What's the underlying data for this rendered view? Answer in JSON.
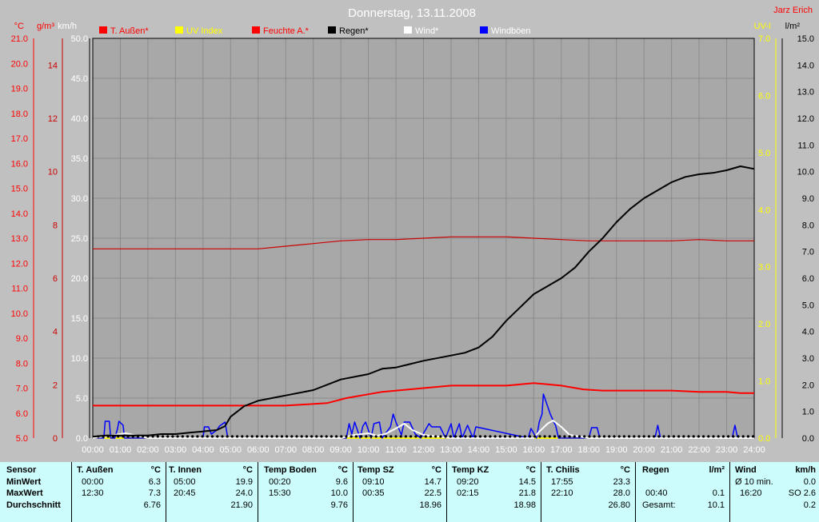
{
  "title": "Donnerstag, 13.11.2008",
  "owner": "Jarz Erich",
  "colors": {
    "background": "#c0c0c0",
    "plot": "#a8a8a8",
    "grid": "#8c8c8c",
    "temp": "#ff0000",
    "humidity": "#cc0000",
    "rain": "#000000",
    "wind": "#ffffff",
    "gust": "#0000ff",
    "uv": "#ffff00",
    "table": "#cdfcfc"
  },
  "chart_data": {
    "type": "line",
    "title": "Donnerstag, 13.11.2008",
    "x_ticks": [
      "00:00",
      "01:00",
      "02:00",
      "03:00",
      "04:00",
      "05:00",
      "06:00",
      "07:00",
      "08:00",
      "09:00",
      "10:00",
      "11:00",
      "12:00",
      "13:00",
      "14:00",
      "15:00",
      "16:00",
      "17:00",
      "18:00",
      "19:00",
      "20:00",
      "21:00",
      "22:00",
      "23:00",
      "24:00"
    ],
    "x_range_hours": [
      0,
      24
    ],
    "legend": [
      "T. Außen*",
      "UV Index",
      "Feuchte A.*",
      "Regen*",
      "Wind*",
      "Windböen"
    ],
    "axes": {
      "temp": {
        "unit": "°C",
        "range": [
          5.0,
          21.0
        ],
        "ticks": [
          "5.0",
          "6.0",
          "7.0",
          "8.0",
          "9.0",
          "10.0",
          "11.0",
          "12.0",
          "13.0",
          "14.0",
          "15.0",
          "16.0",
          "17.0",
          "18.0",
          "19.0",
          "20.0",
          "21.0"
        ]
      },
      "humidity": {
        "unit": "g/m³",
        "range": [
          0,
          15
        ],
        "ticks": [
          "0",
          "2",
          "4",
          "6",
          "8",
          "10",
          "12",
          "14"
        ]
      },
      "wind": {
        "unit": "km/h",
        "range": [
          0,
          50
        ],
        "ticks": [
          "0.0",
          "5.0",
          "10.0",
          "15.0",
          "20.0",
          "25.0",
          "30.0",
          "35.0",
          "40.0",
          "45.0",
          "50.0"
        ]
      },
      "uv": {
        "unit": "UV-I",
        "range": [
          0,
          7
        ],
        "ticks": [
          "0.0",
          "1.0",
          "2.0",
          "3.0",
          "4.0",
          "5.0",
          "6.0",
          "7.0"
        ]
      },
      "rain": {
        "unit": "l/m²",
        "range": [
          0,
          15
        ],
        "ticks": [
          "0.0",
          "1.0",
          "2.0",
          "3.0",
          "4.0",
          "5.0",
          "6.0",
          "7.0",
          "8.0",
          "9.0",
          "10.0",
          "11.0",
          "12.0",
          "13.0",
          "14.0",
          "15.0"
        ]
      }
    },
    "series": [
      {
        "name": "T. Außen*",
        "axis": "temp",
        "x": [
          0,
          4,
          6,
          7,
          8.5,
          9.2,
          10.5,
          12,
          13,
          14,
          15,
          16,
          16.5,
          17,
          17.8,
          18.5,
          19,
          20,
          21,
          22,
          23,
          23.5,
          24
        ],
        "y": [
          6.3,
          6.3,
          6.3,
          6.3,
          6.4,
          6.6,
          6.85,
          7.0,
          7.1,
          7.1,
          7.1,
          7.2,
          7.15,
          7.1,
          6.95,
          6.9,
          6.9,
          6.9,
          6.9,
          6.85,
          6.85,
          6.8,
          6.8
        ]
      },
      {
        "name": "Feuchte A.*",
        "axis": "humidity",
        "x": [
          0,
          4,
          6,
          7,
          8,
          9,
          10,
          11,
          12,
          13,
          14,
          15,
          16,
          17,
          18,
          19,
          20,
          21,
          22,
          23,
          24
        ],
        "y": [
          7.1,
          7.1,
          7.1,
          7.2,
          7.3,
          7.4,
          7.45,
          7.45,
          7.5,
          7.55,
          7.55,
          7.55,
          7.5,
          7.45,
          7.4,
          7.4,
          7.4,
          7.4,
          7.45,
          7.4,
          7.4
        ]
      },
      {
        "name": "Regen*",
        "axis": "rain",
        "x": [
          0,
          0.5,
          1,
          2,
          2.5,
          3,
          3.5,
          4,
          4.5,
          4.8,
          5,
          5.5,
          6,
          6.5,
          7,
          8,
          9,
          10,
          10.5,
          11,
          12,
          13,
          13.5,
          14,
          14.5,
          15,
          15.5,
          16,
          16.5,
          17,
          17.5,
          18,
          18.5,
          19,
          19.5,
          20,
          20.5,
          21,
          21.5,
          22,
          22.5,
          23,
          23.5,
          24
        ],
        "y": [
          0.05,
          0.1,
          0.1,
          0.1,
          0.15,
          0.15,
          0.2,
          0.25,
          0.3,
          0.45,
          0.8,
          1.2,
          1.4,
          1.5,
          1.6,
          1.8,
          2.2,
          2.4,
          2.6,
          2.65,
          2.9,
          3.1,
          3.2,
          3.4,
          3.8,
          4.4,
          4.9,
          5.4,
          5.7,
          6.0,
          6.4,
          7.0,
          7.5,
          8.1,
          8.6,
          9.0,
          9.3,
          9.6,
          9.8,
          9.9,
          9.95,
          10.05,
          10.2,
          10.1
        ]
      },
      {
        "name": "Wind*",
        "axis": "wind",
        "x": [
          0,
          0.6,
          1.2,
          1.6,
          2,
          3,
          9,
          9.5,
          10,
          10.3,
          10.6,
          11,
          11.3,
          11.6,
          12,
          13,
          15,
          16,
          16.2,
          16.5,
          16.7,
          17,
          17.3,
          18,
          24
        ],
        "y": [
          0,
          0.3,
          0.6,
          0.3,
          0,
          0,
          0,
          0.4,
          0.6,
          0.3,
          0.5,
          1.2,
          1.8,
          1.0,
          0.4,
          0,
          0,
          0,
          0.8,
          1.8,
          2.2,
          1.4,
          0.4,
          0,
          0
        ]
      },
      {
        "name": "Windböen",
        "axis": "wind",
        "x": [
          0,
          0.4,
          0.45,
          0.6,
          0.65,
          0.8,
          0.9,
          0.95,
          1.1,
          1.15,
          4,
          4.05,
          4.2,
          4.3,
          4.5,
          4.6,
          4.8,
          4.9,
          9.2,
          9.3,
          9.4,
          9.5,
          9.7,
          9.8,
          9.9,
          10.1,
          10.2,
          10.4,
          10.5,
          10.8,
          10.9,
          11,
          11.2,
          11.3,
          11.5,
          11.7,
          11.9,
          12.2,
          12.3,
          12.6,
          12.8,
          13,
          13.1,
          13.3,
          13.4,
          13.6,
          13.8,
          13.9,
          15.8,
          15.9,
          16.1,
          16.2,
          16.3,
          16.35,
          16.5,
          16.6,
          16.8,
          16.9,
          17.2,
          18,
          18.1,
          18.3,
          18.4,
          20.4,
          20.5,
          20.6,
          23.2,
          23.3,
          23.4,
          24
        ],
        "y": [
          0,
          0,
          2.1,
          2.1,
          0,
          0,
          1.2,
          2.1,
          1.6,
          0,
          0,
          1.4,
          1.4,
          0.5,
          1.0,
          1.5,
          2.0,
          0,
          0,
          1.8,
          0.5,
          2.0,
          0,
          1.5,
          2.0,
          0,
          1.8,
          2.0,
          0,
          1.4,
          3.0,
          2.0,
          0.4,
          2.0,
          2.0,
          0.5,
          0,
          1.8,
          1.4,
          1.4,
          0,
          1.8,
          0,
          1.8,
          0,
          1.6,
          0,
          1.4,
          0,
          1.2,
          0,
          2.0,
          3.0,
          5.5,
          4.0,
          3.0,
          1.5,
          0,
          0,
          0,
          1.3,
          1.3,
          0,
          0,
          1.6,
          0,
          0,
          1.6,
          0,
          0
        ]
      },
      {
        "name": "UV Index",
        "axis": "uv",
        "x": [
          0,
          24
        ],
        "y": [
          0,
          0
        ]
      }
    ]
  },
  "table": {
    "rows": [
      "MinWert",
      "MaxWert",
      "Durchschnitt"
    ],
    "sensor_label": "Sensor",
    "columns": [
      {
        "name": "T. Außen",
        "unit": "°C",
        "min_time": "00:00",
        "min": "6.3",
        "max_time": "12:30",
        "max": "7.3",
        "avg": "6.76"
      },
      {
        "name": "T. Innen",
        "unit": "°C",
        "min_time": "05:00",
        "min": "19.9",
        "max_time": "20:45",
        "max": "24.0",
        "avg": "21.90"
      },
      {
        "name": "Temp Boden",
        "unit": "°C",
        "min_time": "00:20",
        "min": "9.6",
        "max_time": "15:30",
        "max": "10.0",
        "avg": "9.76"
      },
      {
        "name": "Temp SZ",
        "unit": "°C",
        "min_time": "09:10",
        "min": "14.7",
        "max_time": "00:35",
        "max": "22.5",
        "avg": "18.96"
      },
      {
        "name": "Temp KZ",
        "unit": "°C",
        "min_time": "09:20",
        "min": "14.5",
        "max_time": "02:15",
        "max": "21.8",
        "avg": "18.98"
      },
      {
        "name": "T. Chilis",
        "unit": "°C",
        "min_time": "17:55",
        "min": "23.3",
        "max_time": "22:10",
        "max": "28.0",
        "avg": "26.80"
      }
    ],
    "rain": {
      "name": "Regen",
      "unit": "l/m²",
      "min_time": "00:40",
      "min": "0.1",
      "total_label": "Gesamt:",
      "total": "10.1"
    },
    "wind": {
      "name": "Wind",
      "unit": "km/h",
      "avg_label": "Ø 10 min.",
      "avg": "0.0",
      "max_time": "16:20",
      "max": "SO 2.6",
      "day_avg": "0.2"
    }
  }
}
